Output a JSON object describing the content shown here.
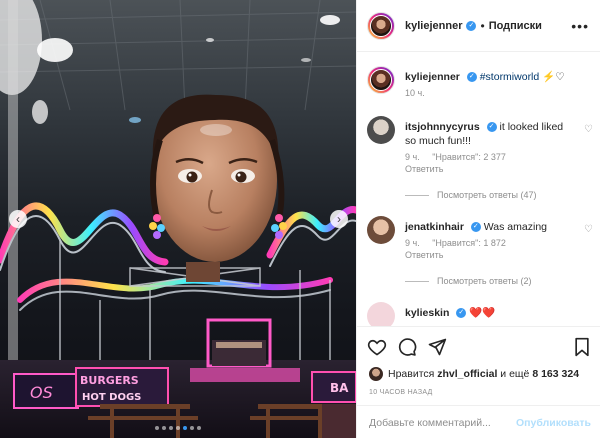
{
  "post": {
    "username": "kyliejenner",
    "header_separator": "•",
    "follow_label": "Подписки",
    "more_icon": "more-horizontal-icon",
    "caption": {
      "username": "kyliejenner",
      "hashtag": "#stormiworld",
      "emoji": "⚡️♡",
      "time": "10 ч."
    }
  },
  "comments": [
    {
      "username": "itsjohnnycyrus",
      "text": "it looked liked so much fun!!!",
      "time": "9 ч.",
      "likes": "\"Нравится\": 2 377",
      "reply_label": "Ответить",
      "view_replies": "Посмотреть ответы (47)"
    },
    {
      "username": "jenatkinhair",
      "text": "Was amazing",
      "time": "9 ч.",
      "likes": "\"Нравится\": 1 872",
      "reply_label": "Ответить",
      "view_replies": "Посмотреть ответы (2)"
    },
    {
      "username": "kylieskin",
      "text": "❤️❤️"
    }
  ],
  "actions": {
    "likes_prefix": "Нравится",
    "likes_user": "zhvl_official",
    "likes_suffix": "и ещё",
    "likes_count": "8 163 324",
    "timestamp": "10 ЧАСОВ НАЗАД",
    "comment_placeholder": "Добавьте комментарий...",
    "publish_label": "Опубликовать"
  },
  "media": {
    "signs": [
      "OS",
      "BURGERS",
      "HOT DOGS",
      "BA"
    ],
    "carousel_dots": 7,
    "active_dot": 4
  },
  "colors": {
    "accent": "#3897f0",
    "link": "#00376b",
    "muted": "#8e8e8e",
    "publish_disabled": "#b2dffc"
  }
}
